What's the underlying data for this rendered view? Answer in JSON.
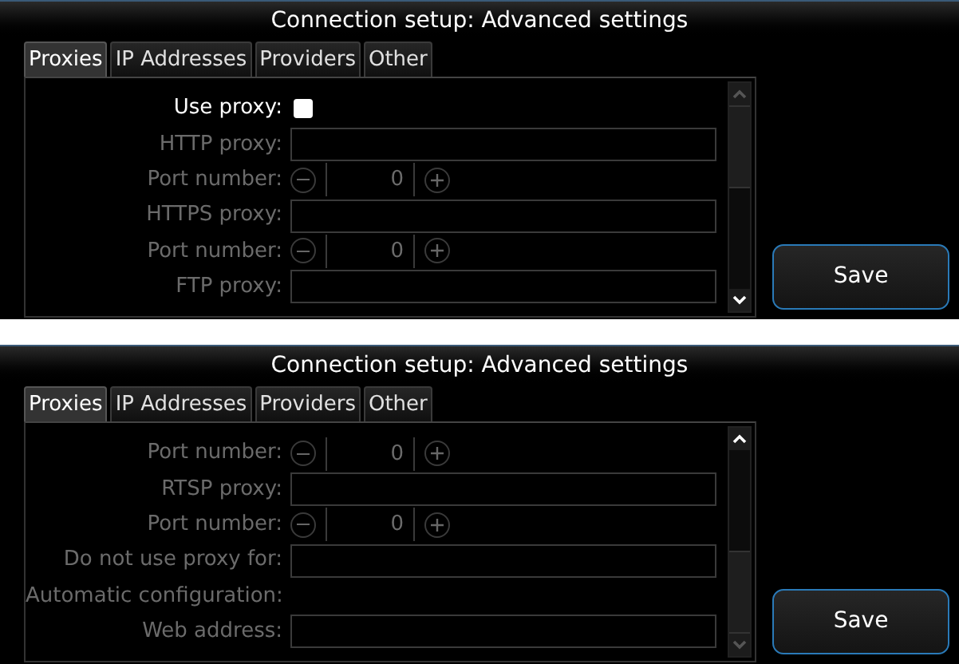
{
  "screens": [
    {
      "title": "Connection setup: Advanced settings",
      "tabs": [
        {
          "label": "Proxies",
          "selected": true
        },
        {
          "label": "IP Addresses",
          "selected": false
        },
        {
          "label": "Providers",
          "selected": false
        },
        {
          "label": "Other",
          "selected": false
        }
      ],
      "rows": [
        {
          "kind": "checkbox",
          "label": "Use proxy:",
          "disabled": false,
          "checked": false
        },
        {
          "kind": "text",
          "label": "HTTP proxy:",
          "disabled": true
        },
        {
          "kind": "spinner",
          "label": "Port number:",
          "disabled": true,
          "value": "0"
        },
        {
          "kind": "text",
          "label": "HTTPS proxy:",
          "disabled": true
        },
        {
          "kind": "spinner",
          "label": "Port number:",
          "disabled": true,
          "value": "0"
        },
        {
          "kind": "text",
          "label": "FTP proxy:",
          "disabled": true
        }
      ],
      "save_button": "Save"
    },
    {
      "title": "Connection setup: Advanced settings",
      "tabs": [
        {
          "label": "Proxies",
          "selected": true
        },
        {
          "label": "IP Addresses",
          "selected": false
        },
        {
          "label": "Providers",
          "selected": false
        },
        {
          "label": "Other",
          "selected": false
        }
      ],
      "rows": [
        {
          "kind": "spinner",
          "label": "Port number:",
          "disabled": true,
          "value": "0"
        },
        {
          "kind": "text",
          "label": "RTSP proxy:",
          "disabled": true
        },
        {
          "kind": "spinner",
          "label": "Port number:",
          "disabled": true,
          "value": "0"
        },
        {
          "kind": "text",
          "label": "Do not use proxy for:",
          "disabled": true
        },
        {
          "kind": "heading",
          "label": "Automatic configuration:",
          "disabled": true
        },
        {
          "kind": "text",
          "label": "Web address:",
          "disabled": true
        }
      ],
      "save_button": "Save"
    }
  ]
}
